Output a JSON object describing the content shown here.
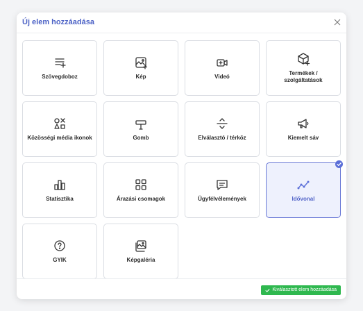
{
  "dialog": {
    "title": "Új elem hozzáadása",
    "confirm_label": "Kiválasztott elem hozzáadása"
  },
  "items": [
    {
      "label": "Szövegdoboz",
      "icon": "text-box-icon",
      "selected": false
    },
    {
      "label": "Kép",
      "icon": "image-add-icon",
      "selected": false
    },
    {
      "label": "Videó",
      "icon": "video-icon",
      "selected": false
    },
    {
      "label": "Termékek / szolgáltatások",
      "icon": "product-box-icon",
      "selected": false
    },
    {
      "label": "Közösségi média ikonok",
      "icon": "social-shapes-icon",
      "selected": false
    },
    {
      "label": "Gomb",
      "icon": "button-cursor-icon",
      "selected": false
    },
    {
      "label": "Elválasztó / térköz",
      "icon": "divider-icon",
      "selected": false
    },
    {
      "label": "Kiemelt sáv",
      "icon": "megaphone-icon",
      "selected": false
    },
    {
      "label": "Statisztika",
      "icon": "bar-chart-icon",
      "selected": false
    },
    {
      "label": "Árazási csomagok",
      "icon": "grid-icon",
      "selected": false
    },
    {
      "label": "Ügyfélvélemények",
      "icon": "message-icon",
      "selected": false
    },
    {
      "label": "Idővonal",
      "icon": "timeline-icon",
      "selected": true
    },
    {
      "label": "GYIK",
      "icon": "question-circle-icon",
      "selected": false
    },
    {
      "label": "Képgaléria",
      "icon": "gallery-icon",
      "selected": false
    }
  ],
  "colors": {
    "accent": "#5b6fd8",
    "title": "#4d63c6",
    "confirm": "#2fb84f"
  }
}
